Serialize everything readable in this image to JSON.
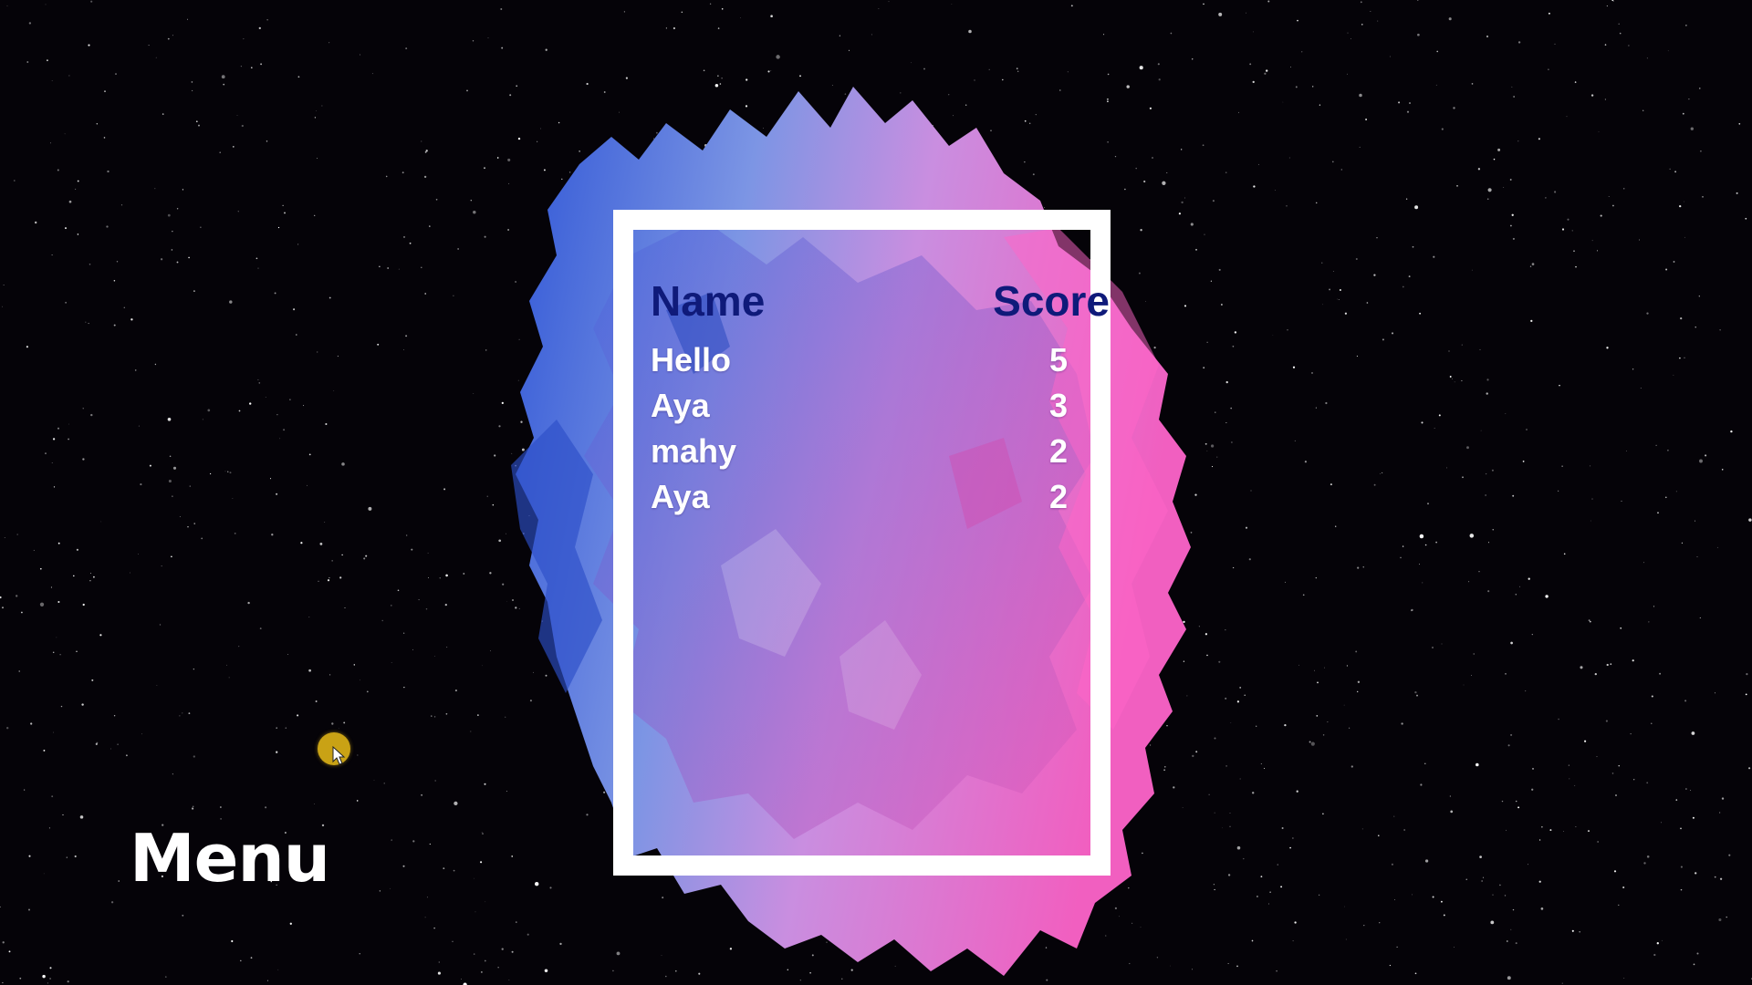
{
  "leaderboard": {
    "header": {
      "name": "Name",
      "score": "Score"
    },
    "rows": [
      {
        "name": "Hello",
        "score": "5"
      },
      {
        "name": "Aya",
        "score": "3"
      },
      {
        "name": "mahy",
        "score": "2"
      },
      {
        "name": "Aya",
        "score": "2"
      }
    ]
  },
  "menu": {
    "label": "Menu"
  },
  "icons": {
    "cursor": "pointer-cursor-icon"
  },
  "colors": {
    "header_text": "#0f1a7a",
    "row_text": "#ffffff",
    "frame": "#ffffff",
    "cursor_highlight": "#c9a215",
    "splash_blue": "#3f63d4",
    "splash_pink": "#f06cc8"
  }
}
